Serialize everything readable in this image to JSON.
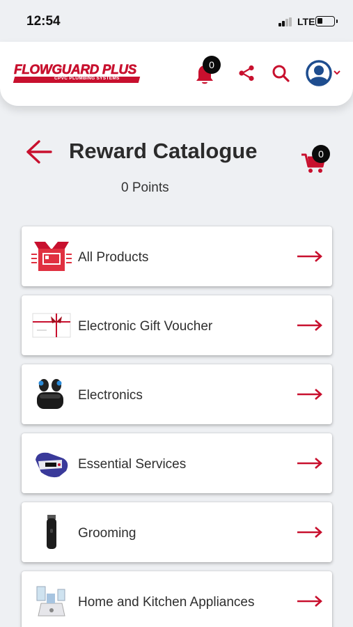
{
  "status": {
    "time": "12:54",
    "network": "LTE"
  },
  "header": {
    "logo_text": "FLOWGUARD PLUS",
    "logo_sub": "CPVC PLUMBING SYSTEMS",
    "notification_count": "0",
    "icons": [
      "bell-icon",
      "share-icon",
      "search-icon",
      "avatar-icon",
      "chevron-down-icon"
    ]
  },
  "page": {
    "title": "Reward Catalogue",
    "points": "0 Points",
    "cart_count": "0"
  },
  "categories": [
    {
      "label": "All Products"
    },
    {
      "label": "Electronic Gift Voucher"
    },
    {
      "label": "Electronics"
    },
    {
      "label": "Essential Services"
    },
    {
      "label": "Grooming"
    },
    {
      "label": "Home and Kitchen Appliances"
    }
  ],
  "colors": {
    "accent": "#c8102e",
    "avatar": "#1e4d8f",
    "background": "#eef0f3"
  }
}
